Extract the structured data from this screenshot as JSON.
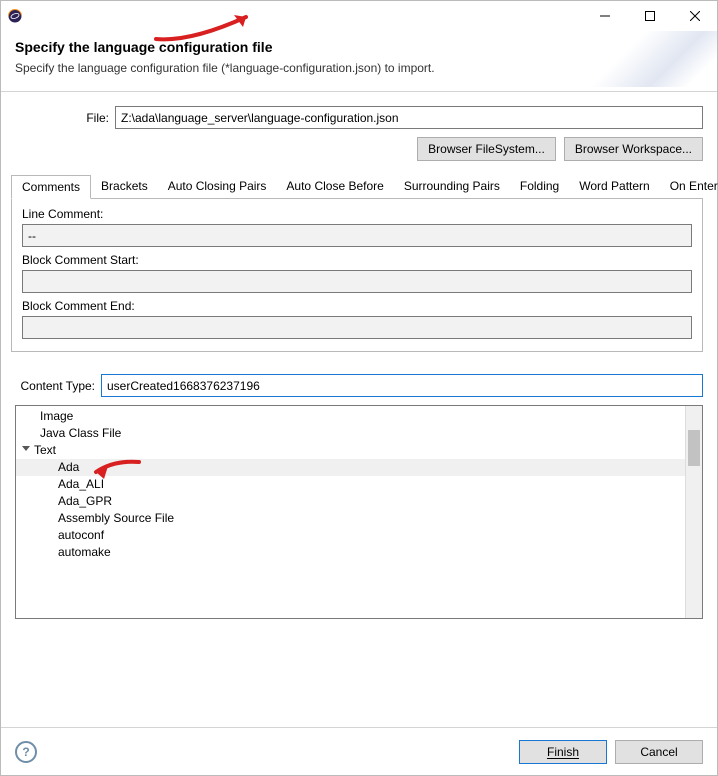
{
  "window": {
    "title": ""
  },
  "header": {
    "title": "Specify the language configuration file",
    "subtitle": "Specify the language configuration file (*language-configuration.json) to import."
  },
  "file": {
    "label": "File:",
    "value": "Z:\\ada\\language_server\\language-configuration.json"
  },
  "buttons": {
    "browse_fs": "Browser FileSystem...",
    "browse_ws": "Browser Workspace..."
  },
  "tabs": {
    "items": [
      {
        "label": "Comments",
        "active": true
      },
      {
        "label": "Brackets"
      },
      {
        "label": "Auto Closing Pairs"
      },
      {
        "label": "Auto Close Before"
      },
      {
        "label": "Surrounding Pairs"
      },
      {
        "label": "Folding"
      },
      {
        "label": "Word Pattern"
      },
      {
        "label": "On Enter Rules"
      }
    ]
  },
  "comments": {
    "line_label": "Line Comment:",
    "line_value": "--",
    "block_start_label": "Block Comment Start:",
    "block_start_value": "",
    "block_end_label": "Block Comment End:",
    "block_end_value": ""
  },
  "content_type": {
    "label": "Content Type:",
    "value": "userCreated1668376237196"
  },
  "tree": {
    "items": [
      {
        "label": "Image",
        "level": 0
      },
      {
        "label": "Java Class File",
        "level": 0
      },
      {
        "label": "Text",
        "level": 0,
        "expanded": true
      },
      {
        "label": "Ada",
        "level": 1,
        "selected": true
      },
      {
        "label": "Ada_ALI",
        "level": 1
      },
      {
        "label": "Ada_GPR",
        "level": 1
      },
      {
        "label": "Assembly Source File",
        "level": 1
      },
      {
        "label": "autoconf",
        "level": 1
      },
      {
        "label": "automake",
        "level": 1
      }
    ]
  },
  "footer": {
    "finish": "Finish",
    "cancel": "Cancel"
  }
}
